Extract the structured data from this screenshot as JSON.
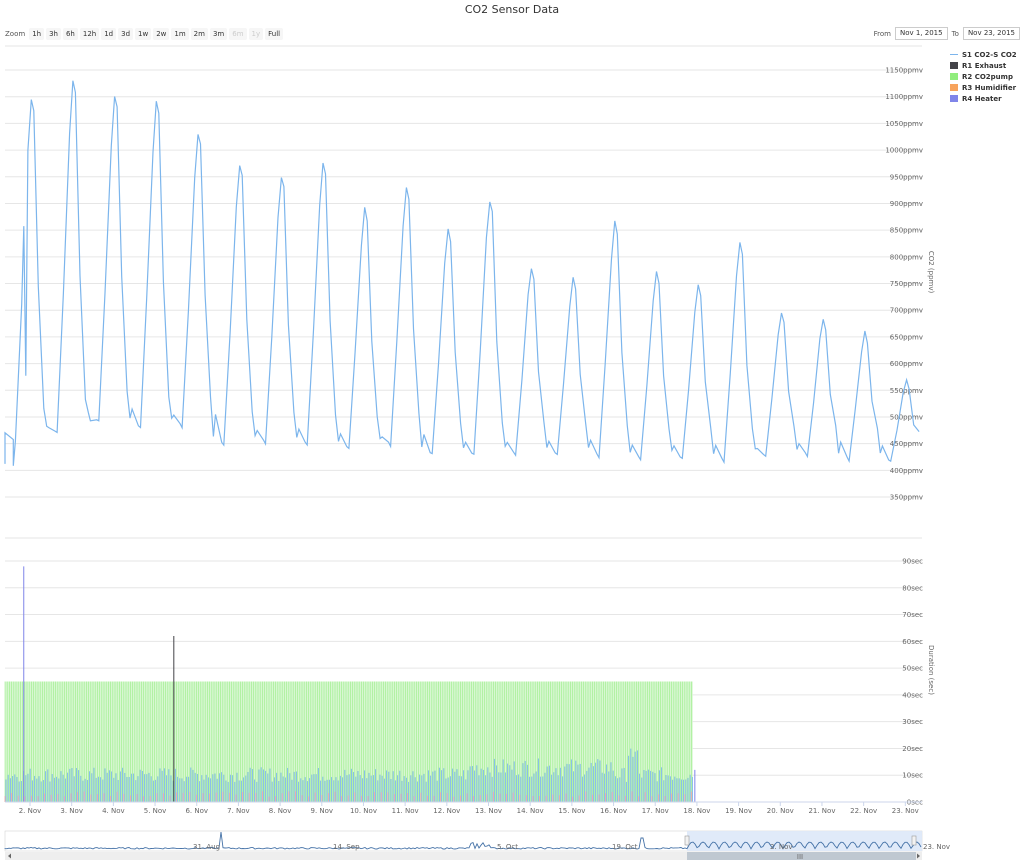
{
  "title": "CO2 Sensor Data",
  "zoom": {
    "label": "Zoom",
    "buttons": [
      {
        "label": "1h",
        "enabled": true
      },
      {
        "label": "3h",
        "enabled": true
      },
      {
        "label": "6h",
        "enabled": true
      },
      {
        "label": "12h",
        "enabled": true
      },
      {
        "label": "1d",
        "enabled": true
      },
      {
        "label": "3d",
        "enabled": true
      },
      {
        "label": "1w",
        "enabled": true
      },
      {
        "label": "2w",
        "enabled": true
      },
      {
        "label": "1m",
        "enabled": true
      },
      {
        "label": "2m",
        "enabled": true
      },
      {
        "label": "3m",
        "enabled": true
      },
      {
        "label": "6m",
        "enabled": false
      },
      {
        "label": "1y",
        "enabled": false
      },
      {
        "label": "Full",
        "enabled": true
      }
    ]
  },
  "range": {
    "from_label": "From",
    "from_value": "Nov 1, 2015",
    "to_label": "To",
    "to_value": "Nov 23, 2015"
  },
  "legend": [
    {
      "label": "S1 CO2-S CO2",
      "color": "#7cb5ec",
      "kind": "line"
    },
    {
      "label": "R1 Exhaust",
      "color": "#434348",
      "kind": "box"
    },
    {
      "label": "R2 CO2pump",
      "color": "#90ed7d",
      "kind": "box"
    },
    {
      "label": "R3 Humidifier",
      "color": "#f7a35c",
      "kind": "box"
    },
    {
      "label": "R4 Heater",
      "color": "#8085e9",
      "kind": "box"
    }
  ],
  "chart_data": [
    {
      "type": "line",
      "series": [
        {
          "name": "S1 CO2-S CO2",
          "color": "#7cb5ec"
        }
      ],
      "ylabel": "CO2 (ppmv)",
      "yticks": [
        "1150ppmv",
        "1100ppmv",
        "1050ppmv",
        "1000ppmv",
        "950ppmv",
        "900ppmv",
        "850ppmv",
        "800ppmv",
        "750ppmv",
        "700ppmv",
        "650ppmv",
        "600ppmv",
        "550ppmv",
        "500ppmv",
        "450ppmv",
        "400ppmv",
        "350ppmv"
      ],
      "ylim": [
        350,
        1150
      ],
      "xlim": [
        1.4,
        23.4
      ],
      "daily_cycles": [
        {
          "day": 1,
          "min": 455,
          "peak": 1095,
          "spike": 860
        },
        {
          "day": 2,
          "min": 470,
          "peak": 1130
        },
        {
          "day": 3,
          "min": 490,
          "peak": 1100
        },
        {
          "day": 4,
          "min": 480,
          "peak": 1090
        },
        {
          "day": 5,
          "min": 480,
          "peak": 1030
        },
        {
          "day": 6,
          "min": 450,
          "peak": 970
        },
        {
          "day": 7,
          "min": 450,
          "peak": 950
        },
        {
          "day": 8,
          "min": 445,
          "peak": 975
        },
        {
          "day": 9,
          "min": 440,
          "peak": 890
        },
        {
          "day": 10,
          "min": 445,
          "peak": 930
        },
        {
          "day": 11,
          "min": 430,
          "peak": 850
        },
        {
          "day": 12,
          "min": 430,
          "peak": 905
        },
        {
          "day": 13,
          "min": 430,
          "peak": 780
        },
        {
          "day": 14,
          "min": 430,
          "peak": 760
        },
        {
          "day": 15,
          "min": 425,
          "peak": 865
        },
        {
          "day": 16,
          "min": 420,
          "peak": 770
        },
        {
          "day": 17,
          "min": 420,
          "peak": 745
        },
        {
          "day": 18,
          "min": 415,
          "peak": 825
        },
        {
          "day": 19,
          "min": 425,
          "peak": 695
        },
        {
          "day": 20,
          "min": 425,
          "peak": 685
        },
        {
          "day": 21,
          "min": 420,
          "peak": 660
        },
        {
          "day": 22,
          "min": 415,
          "peak": 570
        }
      ]
    },
    {
      "type": "bar",
      "ylabel": "Duration (sec)",
      "yticks": [
        "90sec",
        "80sec",
        "70sec",
        "60sec",
        "50sec",
        "40sec",
        "30sec",
        "20sec",
        "10sec",
        "0sec"
      ],
      "ylim": [
        0,
        90
      ],
      "xlim": [
        1.4,
        23.4
      ],
      "xticks": [
        "2. Nov",
        "3. Nov",
        "4. Nov",
        "5. Nov",
        "6. Nov",
        "7. Nov",
        "8. Nov",
        "9. Nov",
        "10. Nov",
        "11. Nov",
        "12. Nov",
        "13. Nov",
        "14. Nov",
        "15. Nov",
        "16. Nov",
        "17. Nov",
        "18. Nov",
        "19. Nov",
        "20. Nov",
        "21. Nov",
        "22. Nov",
        "23. Nov"
      ],
      "series": [
        {
          "name": "R2 CO2pump",
          "color": "#90ed7d",
          "x_range": [
            1.4,
            17.9
          ],
          "value": 45
        },
        {
          "name": "R1 Exhaust",
          "color": "#434348",
          "spikes": [
            {
              "x": 5.45,
              "value": 62
            }
          ]
        },
        {
          "name": "R4 Heater",
          "color": "#8085e9",
          "spikes": [
            {
              "x": 1.85,
              "value": 88
            }
          ]
        },
        {
          "name": "S1 CO2-S CO2",
          "color": "#7cb5ec",
          "x_range": [
            1.4,
            17.9
          ],
          "typical_value": 10
        }
      ]
    }
  ],
  "navigator": {
    "labels": [
      "31. Aug",
      "14. Sep",
      "5. Oct",
      "19. Oct",
      "2. Nov",
      "23. Nov"
    ]
  },
  "scrollbar": {
    "grip": "III"
  }
}
